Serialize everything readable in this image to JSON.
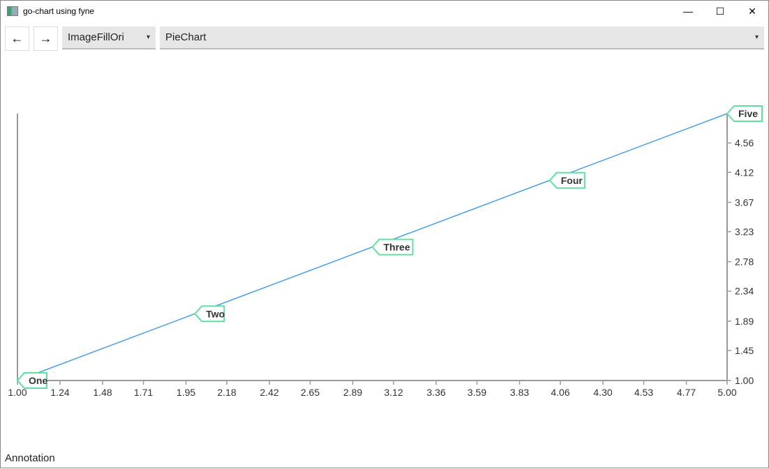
{
  "window": {
    "title": "go-chart using fyne",
    "minimize": "—",
    "maximize": "☐",
    "close": "✕"
  },
  "toolbar": {
    "back_icon": "←",
    "forward_icon": "→",
    "select1": "ImageFillOri",
    "select2": "PieChart",
    "caret": "▾"
  },
  "status": "Annotation",
  "colors": {
    "line": "#4a9ee8",
    "annotation_border": "#5fe0a0",
    "axis": "#999999"
  },
  "chart_data": {
    "type": "line",
    "x": [
      1,
      2,
      3,
      4,
      5
    ],
    "y": [
      1,
      2,
      3,
      4,
      5
    ],
    "annotations": [
      {
        "x": 1,
        "y": 1,
        "label": "One"
      },
      {
        "x": 2,
        "y": 2,
        "label": "Two"
      },
      {
        "x": 3,
        "y": 3,
        "label": "Three"
      },
      {
        "x": 4,
        "y": 4,
        "label": "Four"
      },
      {
        "x": 5,
        "y": 5,
        "label": "Five"
      }
    ],
    "xlim": [
      1,
      5
    ],
    "ylim": [
      1,
      5
    ],
    "xticks": [
      "1.00",
      "1.24",
      "1.48",
      "1.71",
      "1.95",
      "2.18",
      "2.42",
      "2.65",
      "2.89",
      "3.12",
      "3.36",
      "3.59",
      "3.83",
      "4.06",
      "4.30",
      "4.53",
      "4.77",
      "5.00"
    ],
    "yticks": [
      "1.00",
      "1.45",
      "1.89",
      "2.34",
      "2.78",
      "3.23",
      "3.67",
      "4.12",
      "4.56"
    ],
    "y_axis_position": "right",
    "grid": false
  }
}
